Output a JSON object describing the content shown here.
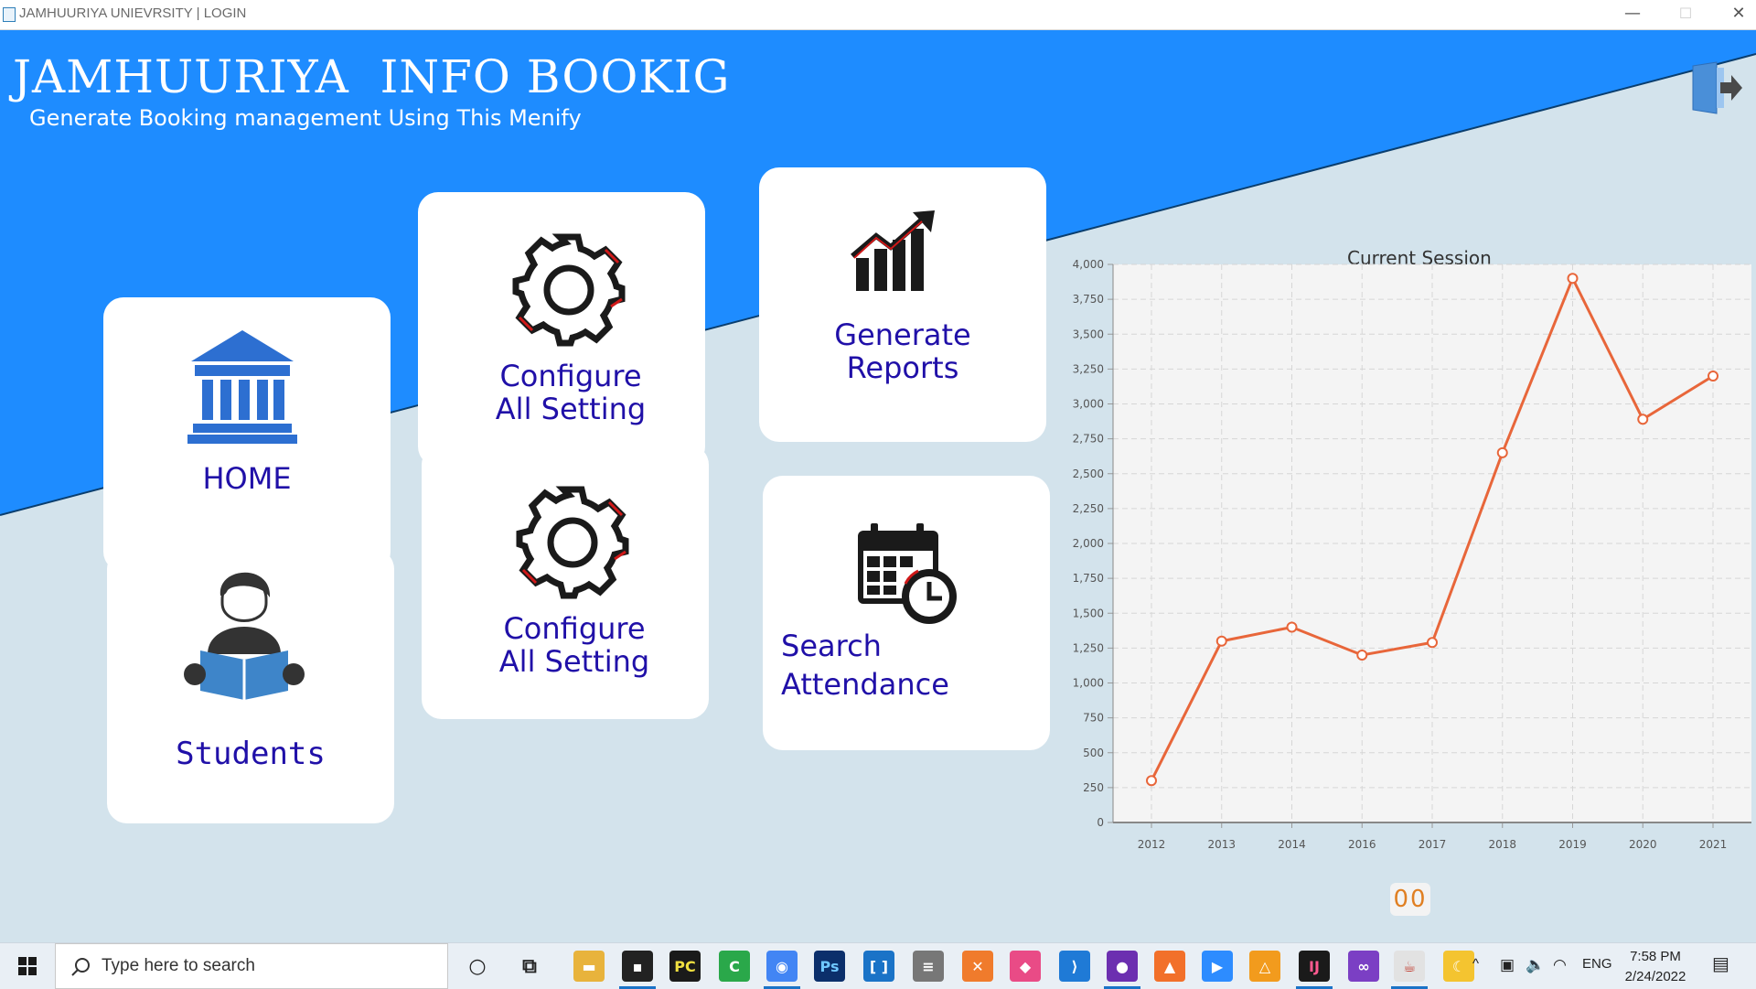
{
  "window": {
    "title": "JAMHUURIYA UNIEVRSITY | LOGIN",
    "minimize_glyph": "—",
    "maximize_glyph": "☐",
    "close_glyph": "✕"
  },
  "header": {
    "title": "Jamhuuriya  Info Bookig",
    "subtitle": "Generate Booking management Using This Menify",
    "logout_icon": "logout-icon"
  },
  "colors": {
    "banner_blue": "#1e8cff",
    "background": "#d3e3ec",
    "card_label": "#2010a8",
    "chart_line": "#e8663a"
  },
  "cards": [
    {
      "id": "home",
      "label": "HOME",
      "icon": "bank-building-icon"
    },
    {
      "id": "students",
      "label": "Students",
      "icon": "student-reading-icon"
    },
    {
      "id": "config_1",
      "label": "Configure\nAll Setting",
      "icon": "gear-icon"
    },
    {
      "id": "config_2",
      "label": "Configure\nAll Setting",
      "icon": "gear-icon"
    },
    {
      "id": "reports",
      "label": "Generate\nReports",
      "icon": "growth-chart-icon"
    },
    {
      "id": "attendance",
      "label": "Search\n Attendance",
      "icon": "calendar-clock-icon"
    }
  ],
  "chart_data": {
    "type": "line",
    "title": "Current Session",
    "categories": [
      "2012",
      "2013",
      "2014",
      "2016",
      "2017",
      "2018",
      "2019",
      "2020",
      "2021"
    ],
    "values": [
      300,
      1300,
      1400,
      1200,
      1290,
      2650,
      3900,
      2890,
      3200
    ],
    "ylim": [
      0,
      4000
    ],
    "yticks": [
      0,
      250,
      500,
      750,
      1000,
      1250,
      1500,
      1750,
      2000,
      2250,
      2500,
      2750,
      3000,
      3250,
      3500,
      3750,
      4000
    ],
    "ytick_labels": [
      "0",
      "250",
      "500",
      "750",
      "1,000",
      "1,250",
      "1,500",
      "1,750",
      "2,000",
      "2,250",
      "2,500",
      "2,750",
      "3,000",
      "3,250",
      "3,500",
      "3,750",
      "4,000"
    ],
    "grid": true,
    "legend": "none"
  },
  "counter": "00",
  "taskbar": {
    "search_placeholder": "Type here to search",
    "apps": [
      {
        "name": "cortana-icon",
        "glyph": "○"
      },
      {
        "name": "task-view-icon",
        "glyph": "⧉"
      },
      {
        "name": "file-explorer-icon",
        "glyph": "▬"
      },
      {
        "name": "terminal-icon",
        "glyph": "▪"
      },
      {
        "name": "pycharm-icon",
        "glyph": "PC"
      },
      {
        "name": "camtasia-icon",
        "glyph": "C"
      },
      {
        "name": "chrome-icon",
        "glyph": "◉"
      },
      {
        "name": "photoshop-icon",
        "glyph": "Ps"
      },
      {
        "name": "bracket-app-icon",
        "glyph": "[ ]"
      },
      {
        "name": "database-icon",
        "glyph": "≡"
      },
      {
        "name": "xampp-icon",
        "glyph": "✕"
      },
      {
        "name": "gitkraken-icon",
        "glyph": "◆"
      },
      {
        "name": "vscode-icon",
        "glyph": "⟩"
      },
      {
        "name": "github-icon",
        "glyph": "●"
      },
      {
        "name": "brave-icon",
        "glyph": "▲"
      },
      {
        "name": "zoom-icon",
        "glyph": "▶"
      },
      {
        "name": "sourcetree-icon",
        "glyph": "△"
      },
      {
        "name": "intellij-icon",
        "glyph": "IJ"
      },
      {
        "name": "visual-studio-icon",
        "glyph": "∞"
      },
      {
        "name": "java-icon",
        "glyph": "☕"
      },
      {
        "name": "weather-icon",
        "glyph": "☾"
      }
    ],
    "tray": {
      "chevron": "^",
      "language": "ENG",
      "time": "7:58 PM",
      "date": "2/24/2022"
    }
  }
}
